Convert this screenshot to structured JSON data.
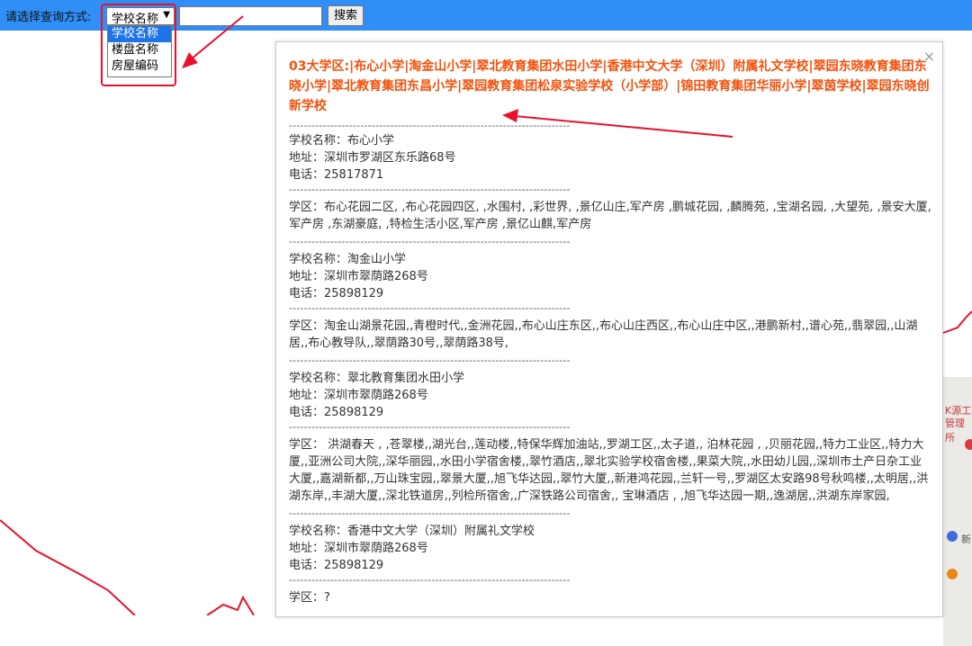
{
  "query_bar": {
    "label": "请选择查询方式:",
    "selected": "学校名称",
    "options": [
      "学校名称",
      "楼盘名称",
      "房屋编码"
    ],
    "search_value": "",
    "search_button": "搜索"
  },
  "popup": {
    "close": "×",
    "title": "03大学区:|布心小学|淘金山小学|翠北教育集团水田小学|香港中文大学（深圳）附属礼文学校|翠园东晓教育集团东晓小学|翠北教育集团东昌小学|翠园教育集团松泉实验学校（小学部）|锦田教育集团华丽小学|翠茵学校|翠园东晓创新学校",
    "separator": "------------------------------------------------------------------------------------",
    "schools": [
      {
        "name": "学校名称：布心小学",
        "address": "地址：深圳市罗湖区东乐路68号",
        "phone": "电话：25817871",
        "district": "学区：布心花园二区, ,布心花园四区, ,水围村, ,彩世界, ,景亿山庄,军产房 ,鹏城花园, ,麟腾苑, ,宝湖名园, ,大望苑, ,景安大厦, 军产房 ,东湖豪庭, ,特检生活小区,军产房 ,景亿山麒,军产房"
      },
      {
        "name": "学校名称：淘金山小学",
        "address": "地址：深圳市翠荫路268号",
        "phone": "电话：25898129",
        "district": "学区：淘金山湖景花园,,青橙时代,,金洲花园,,布心山庄东区,,布心山庄西区,,布心山庄中区,,港鹏新村,,谱心苑,,翡翠园,,山湖居,,布心教导队,,翠荫路30号,,翠荫路38号,"
      },
      {
        "name": "学校名称：翠北教育集团水田小学",
        "address": "地址：深圳市翠荫路268号",
        "phone": "电话：25898129",
        "district": "学区： 洪湖春天 , ,苍翠楼,,湖光台,,莲动楼,,特保华辉加油站,,罗湖工区,,太子道,, 泊林花园 , ,贝丽花园,,特力工业区,,特力大厦,,亚洲公司大院,,深华丽园,,水田小学宿舍楼,,翠竹酒店,,翠北实验学校宿舍楼,,果菜大院,,水田幼儿园,,深圳市土产日杂工业大厦,,嘉湖新都,,万山珠宝园,,翠景大厦,,旭飞华达园,,翠竹大厦,,新港鸿花园,,兰轩一号,,罗湖区太安路98号秋鸣楼,,太明居,,洪湖东岸,,丰湖大厦,,深北铁道房,,列检所宿舍,,广深铁路公司宿舍,, 宝琳酒店 , ,旭飞华达园一期,,逸湖居,,洪湖东岸家园,"
      },
      {
        "name": "学校名称：香港中文大学（深圳）附属礼文学校",
        "address": "地址：深圳市翠荫路268号",
        "phone": "电话：25898129",
        "district": "学区：?"
      }
    ]
  },
  "map": {
    "labels": [
      "K源工",
      "管理所",
      "新"
    ]
  },
  "colors": {
    "topbar": "#2f8ff6",
    "title": "#f2520d",
    "annotation_red": "#e8112d",
    "selected_option": "#1e73e8"
  }
}
